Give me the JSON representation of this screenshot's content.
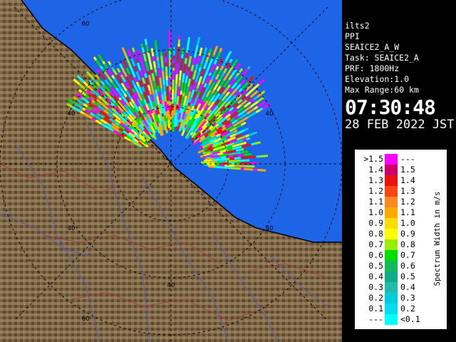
{
  "info": {
    "lines": [
      "ilts2",
      "PPI",
      "SEAICE2_A_W",
      "Task: SEAICE2_A",
      "PRF: 1800Hz",
      "Elevation:1.0",
      "Max Range:60 km"
    ],
    "time": "07:30:48",
    "date": "28 FEB 2022 JST"
  },
  "map": {
    "range_labels": [
      "60",
      "40",
      "40",
      "40",
      "40",
      "40",
      "60"
    ],
    "sea_color": "#1e64e6",
    "land_color": "#7a6040"
  },
  "legend": {
    "title": "Spectrum Width in m/s",
    "rows": [
      {
        "left": ">1.5",
        "right": "---",
        "color": "#ff00ff"
      },
      {
        "left": "1.4",
        "right": "1.5",
        "color": "#cc0066"
      },
      {
        "left": "1.3",
        "right": "1.4",
        "color": "#ee1111"
      },
      {
        "left": "1.2",
        "right": "1.3",
        "color": "#ff4411"
      },
      {
        "left": "1.1",
        "right": "1.2",
        "color": "#ff8822"
      },
      {
        "left": "1.0",
        "right": "1.1",
        "color": "#ffaa00"
      },
      {
        "left": "0.9",
        "right": "1.0",
        "color": "#ffdd00"
      },
      {
        "left": "0.8",
        "right": "0.9",
        "color": "#ffff00"
      },
      {
        "left": "0.7",
        "right": "0.8",
        "color": "#99ee00"
      },
      {
        "left": "0.6",
        "right": "0.7",
        "color": "#00dd00"
      },
      {
        "left": "0.5",
        "right": "0.6",
        "color": "#11bb55"
      },
      {
        "left": "0.4",
        "right": "0.5",
        "color": "#11aa88"
      },
      {
        "left": "0.3",
        "right": "0.4",
        "color": "#22bbaa"
      },
      {
        "left": "0.2",
        "right": "0.3",
        "color": "#00ccdd"
      },
      {
        "left": "0.1",
        "right": "0.2",
        "color": "#00ddee"
      },
      {
        "left": "---",
        "right": "<0.1",
        "color": "#00ffff"
      }
    ]
  }
}
